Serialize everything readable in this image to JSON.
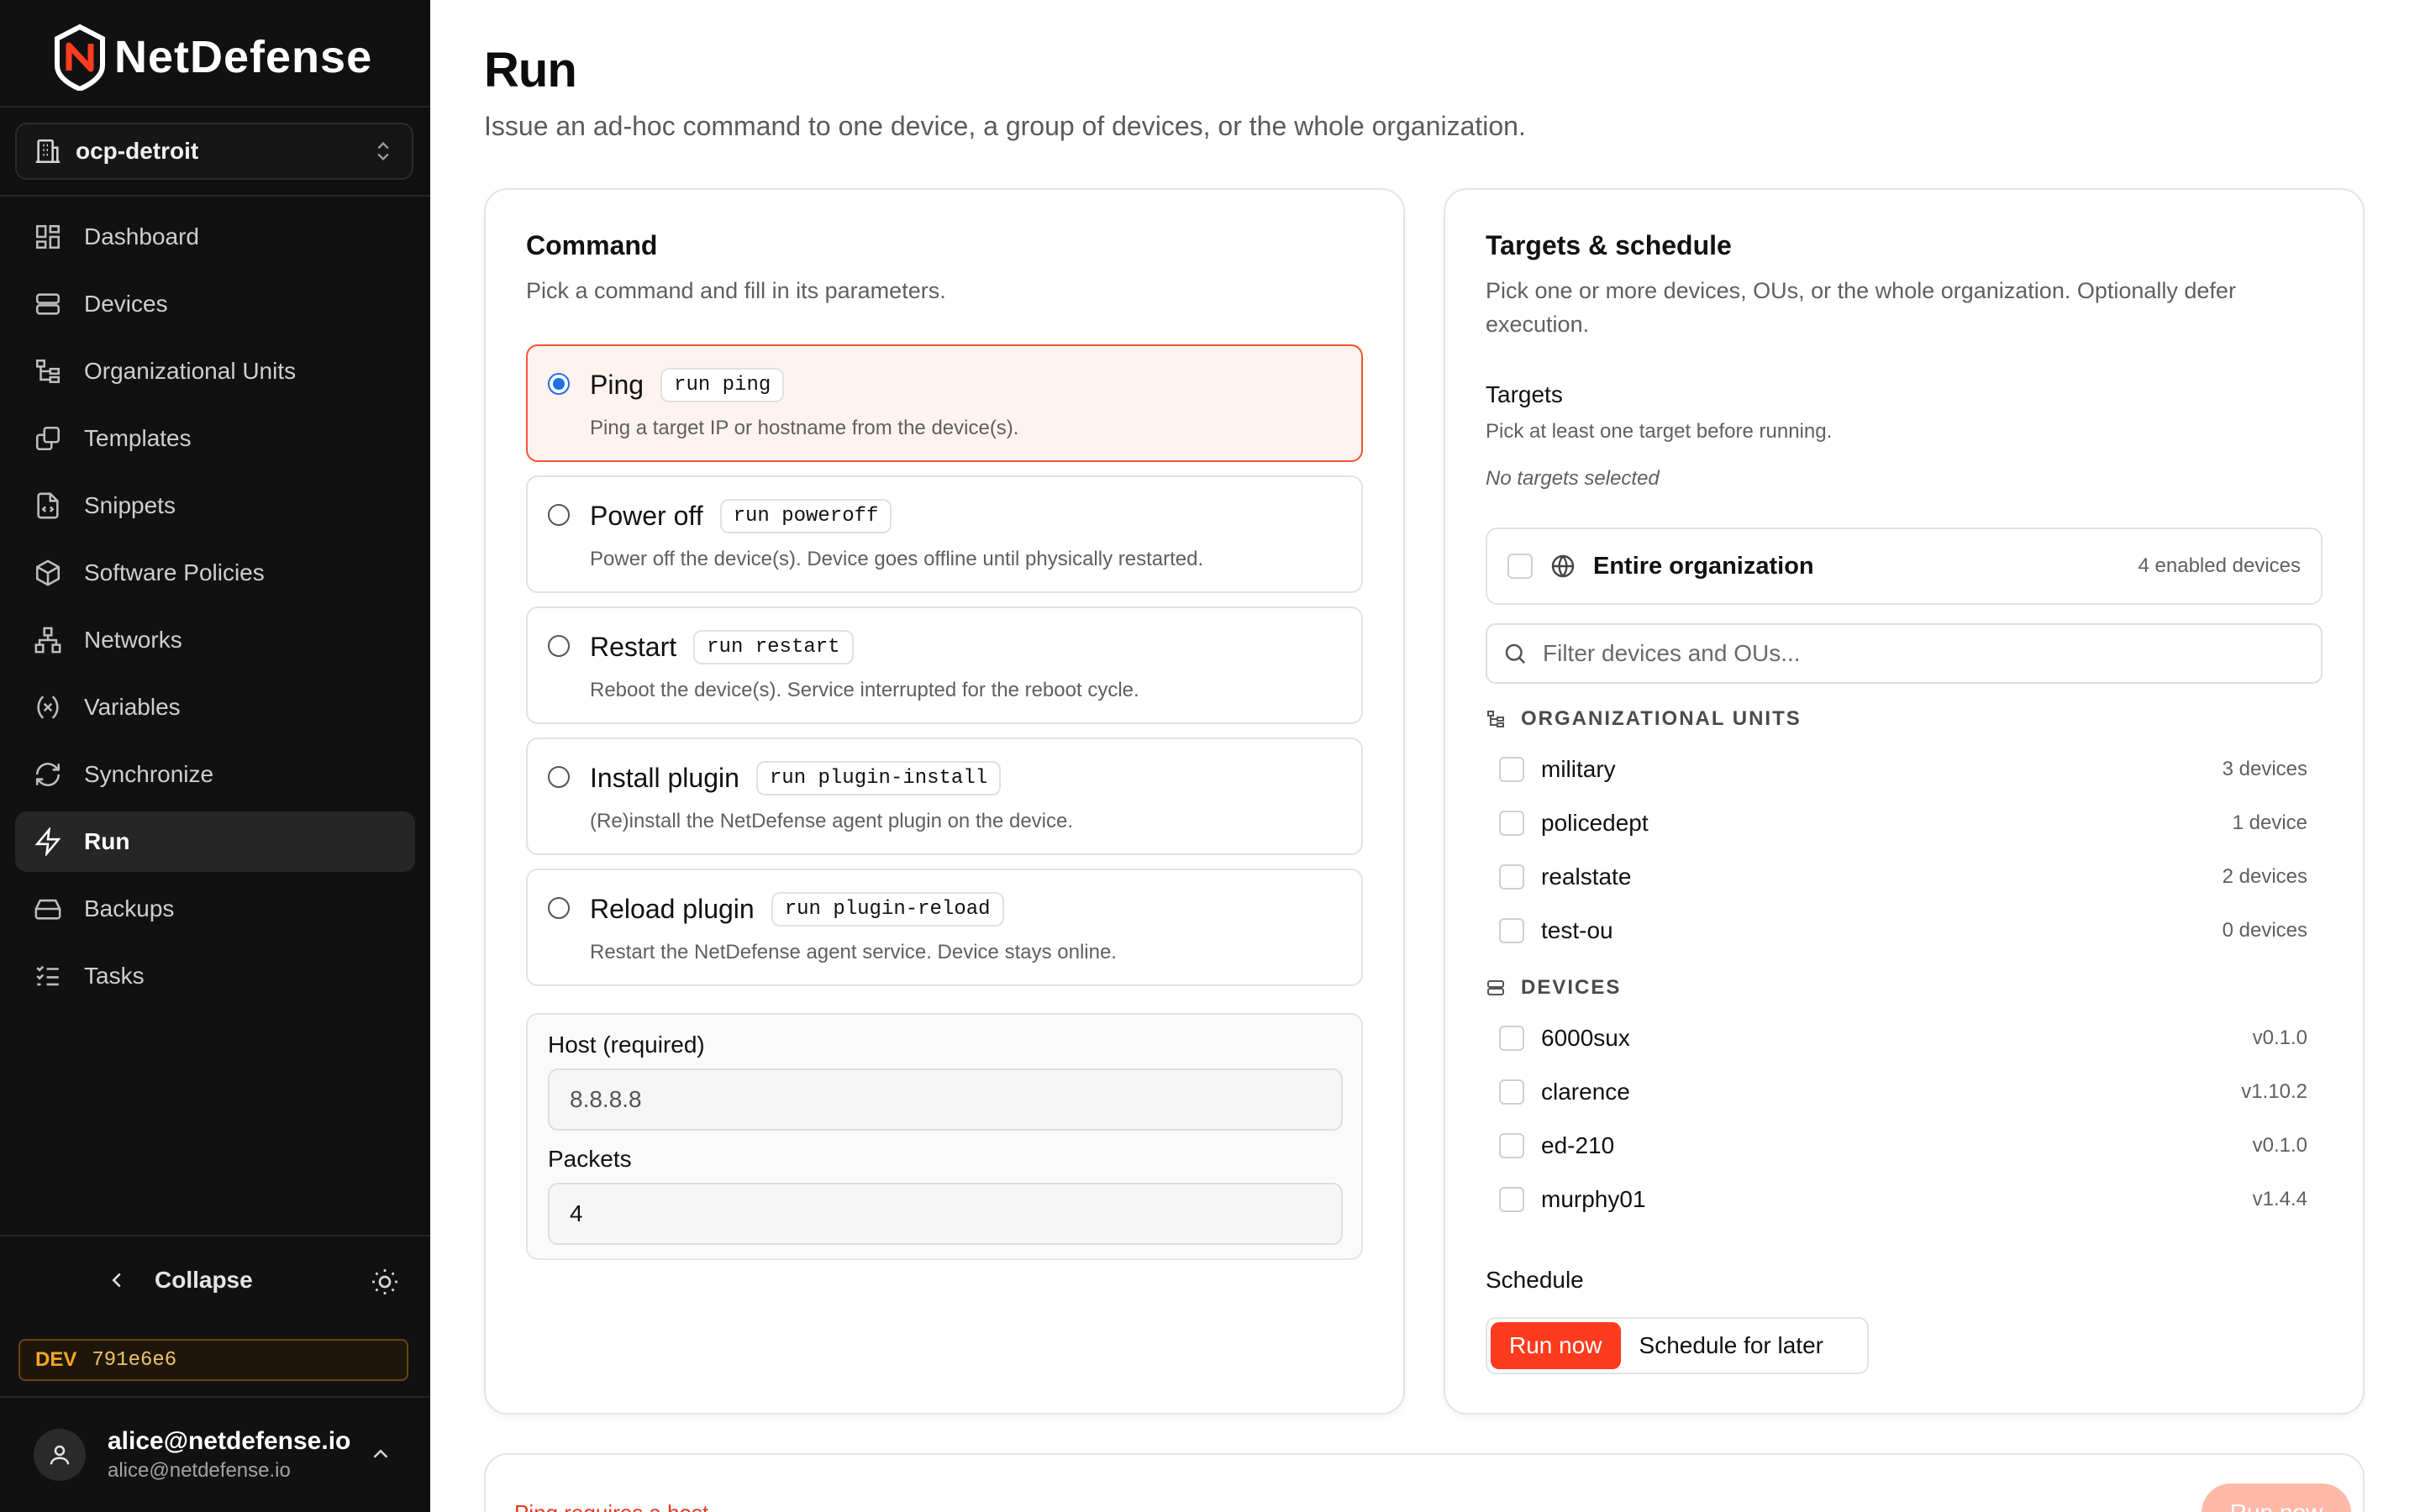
{
  "brand": {
    "name_part1": "Net",
    "name_part2": "Defense",
    "accent": "#ff3b20"
  },
  "org": {
    "name": "ocp-detroit"
  },
  "sidebar": {
    "items": [
      {
        "label": "Dashboard",
        "icon": "dashboard-icon"
      },
      {
        "label": "Devices",
        "icon": "server-icon"
      },
      {
        "label": "Organizational Units",
        "icon": "tree-icon"
      },
      {
        "label": "Templates",
        "icon": "copy-icon"
      },
      {
        "label": "Snippets",
        "icon": "file-code-icon"
      },
      {
        "label": "Software Policies",
        "icon": "package-icon"
      },
      {
        "label": "Networks",
        "icon": "network-icon"
      },
      {
        "label": "Variables",
        "icon": "variable-icon"
      },
      {
        "label": "Synchronize",
        "icon": "refresh-icon"
      },
      {
        "label": "Run",
        "icon": "zap-icon",
        "active": true
      },
      {
        "label": "Backups",
        "icon": "hard-drive-icon"
      },
      {
        "label": "Tasks",
        "icon": "list-checks-icon"
      }
    ],
    "collapse_label": "Collapse",
    "env_tag": "DEV",
    "build_hash": "791e6e6"
  },
  "user": {
    "name": "alice@netdefense.io",
    "email": "alice@netdefense.io"
  },
  "page": {
    "title": "Run",
    "subtitle": "Issue an ad-hoc command to one device, a group of devices, or the whole organization."
  },
  "command": {
    "title": "Command",
    "description": "Pick a command and fill in its parameters.",
    "options": [
      {
        "name": "Ping",
        "code": "run ping",
        "description": "Ping a target IP or hostname from the device(s).",
        "selected": true
      },
      {
        "name": "Power off",
        "code": "run poweroff",
        "description": "Power off the device(s). Device goes offline until physically restarted.",
        "selected": false
      },
      {
        "name": "Restart",
        "code": "run restart",
        "description": "Reboot the device(s). Service interrupted for the reboot cycle.",
        "selected": false
      },
      {
        "name": "Install plugin",
        "code": "run plugin-install",
        "description": "(Re)install the NetDefense agent plugin on the device.",
        "selected": false
      },
      {
        "name": "Reload plugin",
        "code": "run plugin-reload",
        "description": "Restart the NetDefense agent service. Device stays online.",
        "selected": false
      }
    ],
    "params": {
      "host_label": "Host (required)",
      "host_placeholder": "8.8.8.8",
      "packets_label": "Packets",
      "packets_value": "4"
    }
  },
  "targets": {
    "title": "Targets & schedule",
    "description_line1": "Pick one or more devices, OUs, or the whole organization. Optionally defer",
    "description_line2": "execution.",
    "section_label": "Targets",
    "hint": "Pick at least one target before running.",
    "empty_state": "No targets selected",
    "entire_org": {
      "label": "Entire organization",
      "count": "4 enabled devices"
    },
    "filter_placeholder": "Filter devices and OUs...",
    "ou_header": "ORGANIZATIONAL UNITS",
    "ous": [
      {
        "name": "military",
        "meta": "3 devices"
      },
      {
        "name": "policedept",
        "meta": "1 device"
      },
      {
        "name": "realstate",
        "meta": "2 devices"
      },
      {
        "name": "test-ou",
        "meta": "0 devices"
      }
    ],
    "devices_header": "DEVICES",
    "devices": [
      {
        "name": "6000sux",
        "meta": "v0.1.0"
      },
      {
        "name": "clarence",
        "meta": "v1.10.2"
      },
      {
        "name": "ed-210",
        "meta": "v0.1.0"
      },
      {
        "name": "murphy01",
        "meta": "v1.4.4"
      }
    ],
    "schedule_label": "Schedule",
    "schedule_options": [
      {
        "label": "Run now",
        "active": true
      },
      {
        "label": "Schedule for later",
        "active": false
      }
    ]
  },
  "footer": {
    "error": "Ping requires a host",
    "run_button": "Run now"
  },
  "colors": {
    "primary": "#ff3b1f",
    "selected_border": "#f4552e",
    "selected_bg": "#fff3ef",
    "radio": "#1f6feb",
    "error": "#e5381f"
  }
}
